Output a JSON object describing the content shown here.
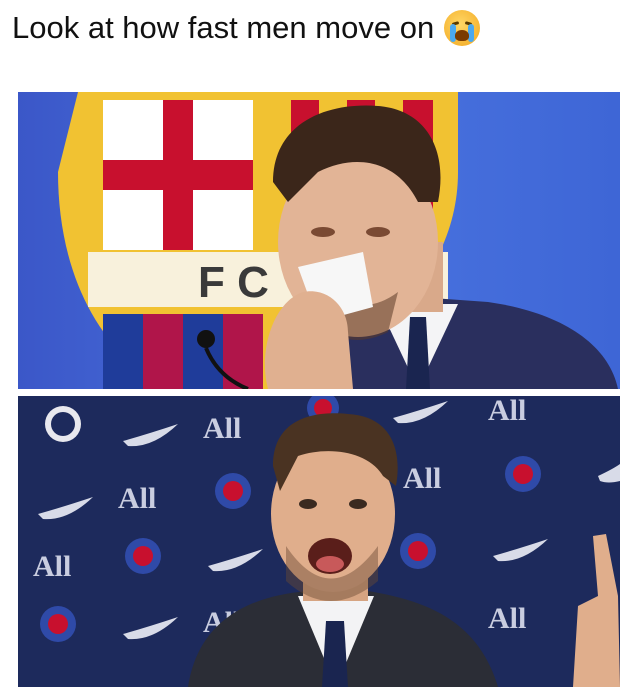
{
  "caption": {
    "text": "Look at how fast men move on",
    "emoji_icon": "loudly-crying-face-icon"
  },
  "top_panel": {
    "crest_letters": "F C",
    "colors": {
      "background": "#3e64d4",
      "crest_gold": "#f1c232",
      "crest_red": "#c8102e",
      "suit": "#2a2f5e"
    }
  },
  "bottom_panel": {
    "backdrop_text": "All",
    "colors": {
      "background": "#1d2a5c",
      "suit": "#2b2d36",
      "shirt": "#f3f3f5",
      "tie": "#1a2550"
    }
  }
}
